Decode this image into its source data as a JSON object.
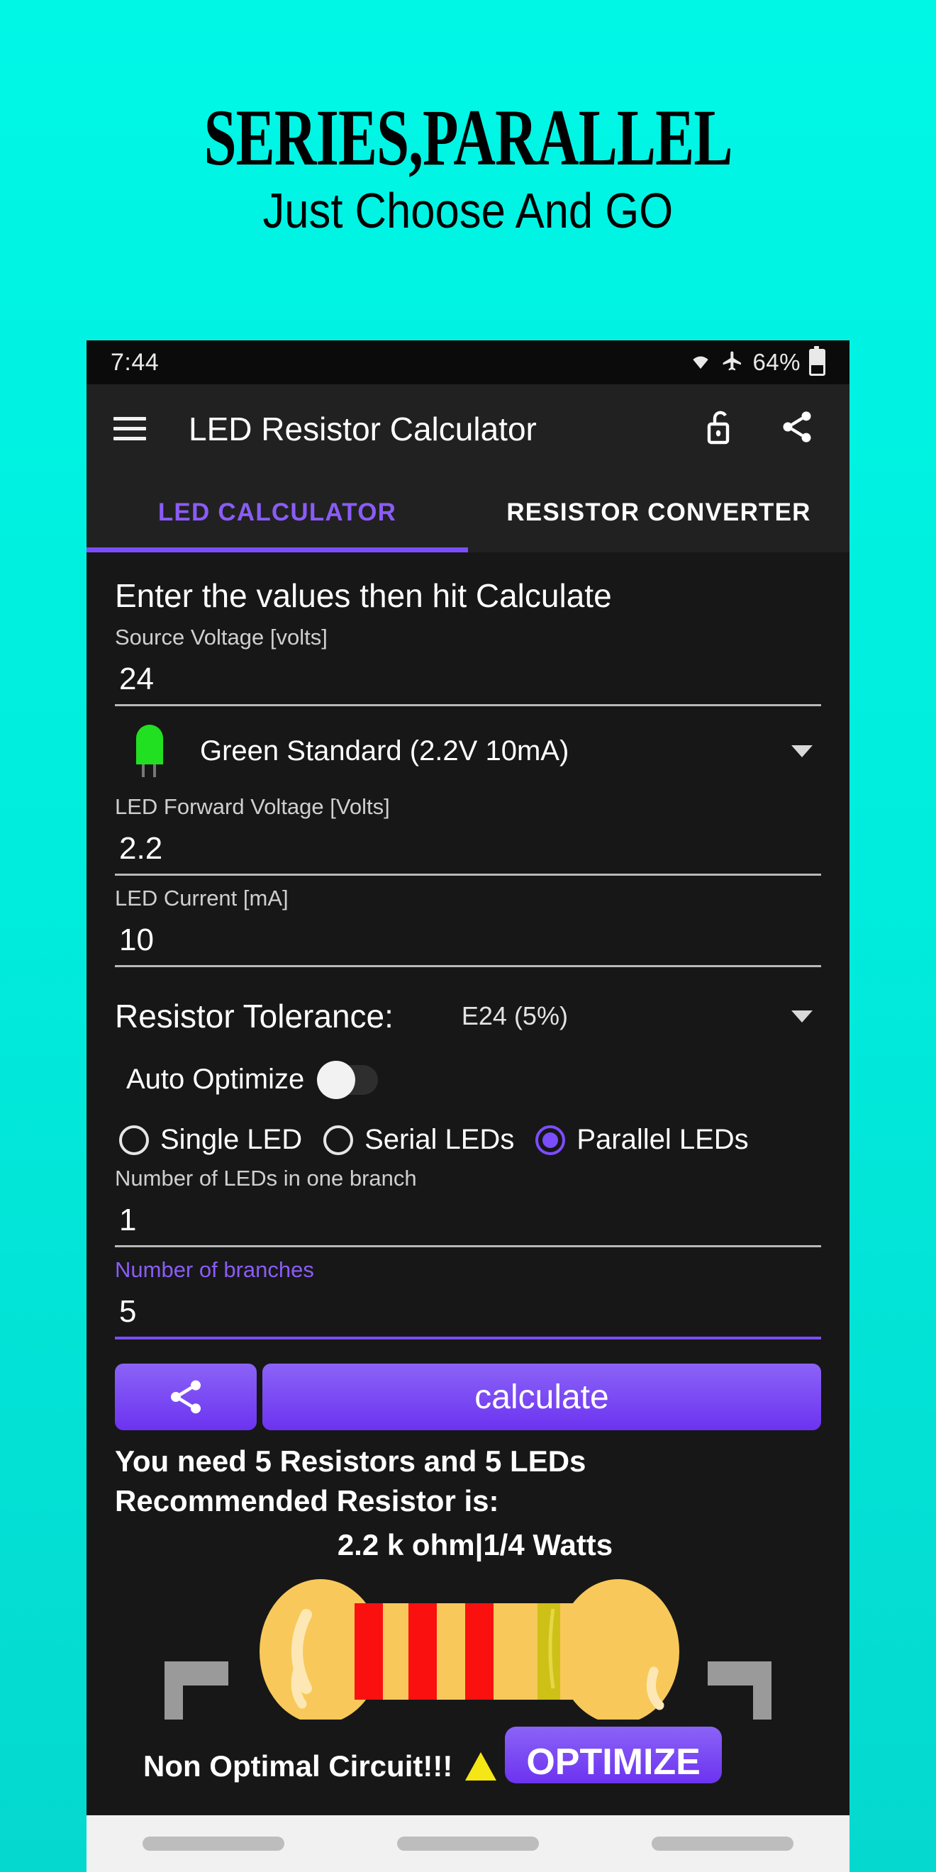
{
  "promo": {
    "title": "SERIES,PARALLEL",
    "subtitle": "Just Choose And GO",
    "bg_color": "#00f7e6"
  },
  "statusbar": {
    "time": "7:44",
    "wifi_icon": "wifi-icon",
    "airplane_icon": "airplane-mode-icon",
    "battery_percent": "64%"
  },
  "appbar": {
    "menu_icon": "hamburger-menu-icon",
    "title": "LED Resistor Calculator",
    "lock_icon": "unlock-icon",
    "share_icon": "share-icon"
  },
  "tabs": {
    "items": [
      {
        "label": "LED CALCULATOR",
        "active": true
      },
      {
        "label": "RESISTOR CONVERTER",
        "active": false
      }
    ],
    "accent_color": "#7c4dff"
  },
  "form": {
    "hint": "Enter the values then hit Calculate",
    "source_voltage": {
      "label": "Source Voltage [volts]",
      "value": "24"
    },
    "led_select": {
      "icon": "led-icon",
      "value": "Green Standard (2.2V 10mA)",
      "caret": "chevron-down-icon"
    },
    "forward_voltage": {
      "label": "LED Forward Voltage [Volts]",
      "value": "2.2"
    },
    "led_current": {
      "label": "LED Current [mA]",
      "value": "10"
    },
    "tolerance": {
      "label": "Resistor Tolerance:",
      "value": "E24 (5%)",
      "caret": "chevron-down-icon"
    },
    "auto_optimize": {
      "label": "Auto Optimize",
      "state": "off"
    },
    "mode_options": [
      {
        "label": "Single LED",
        "selected": false
      },
      {
        "label": "Serial LEDs",
        "selected": false
      },
      {
        "label": "Parallel LEDs",
        "selected": true
      }
    ],
    "leds_per_branch": {
      "label": "Number of LEDs in one branch",
      "value": "1"
    },
    "branches": {
      "label": "Number of branches",
      "value": "5",
      "focused": true
    }
  },
  "actions": {
    "share_icon": "share-icon",
    "calculate_label": "calculate"
  },
  "results": {
    "line1": "You need 5 Resistors and 5 LEDs",
    "line2": "Recommended Resistor is:",
    "line3": "2.2 k ohm|1/4 Watts",
    "resistor_image": "resistor-illustration",
    "warning_text": "Non Optimal Circuit!!!",
    "warning_icon": "warning-triangle-icon",
    "optimize_label": "OPTIMIZE"
  },
  "footer": {
    "bars": [
      "bar-1",
      "bar-2",
      "bar-3"
    ]
  }
}
